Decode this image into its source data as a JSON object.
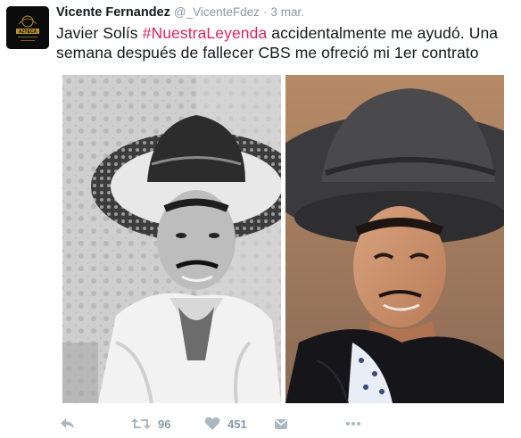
{
  "author": {
    "name": "Vicente Fernandez",
    "handle": "@_VicenteFdez",
    "separator": "·",
    "time": "3 mar.",
    "avatar_text": "AZTECA"
  },
  "tweet": {
    "text_before": "Javier Solís ",
    "hashtag": "#NuestraLeyenda",
    "text_after": " accidentalmente me ayudó. Una semana después de fallecer CBS me ofreció mi 1er contrato"
  },
  "actions": {
    "reply_icon": "reply-icon",
    "retweet_icon": "retweet-icon",
    "retweet_count": "96",
    "like_icon": "heart-icon",
    "like_count": "451",
    "dm_icon": "direct-message-icon",
    "more_icon": "more-icon"
  },
  "colors": {
    "hashtag": "#e0245e",
    "meta": "#8899a6",
    "action": "#aab8c2"
  }
}
